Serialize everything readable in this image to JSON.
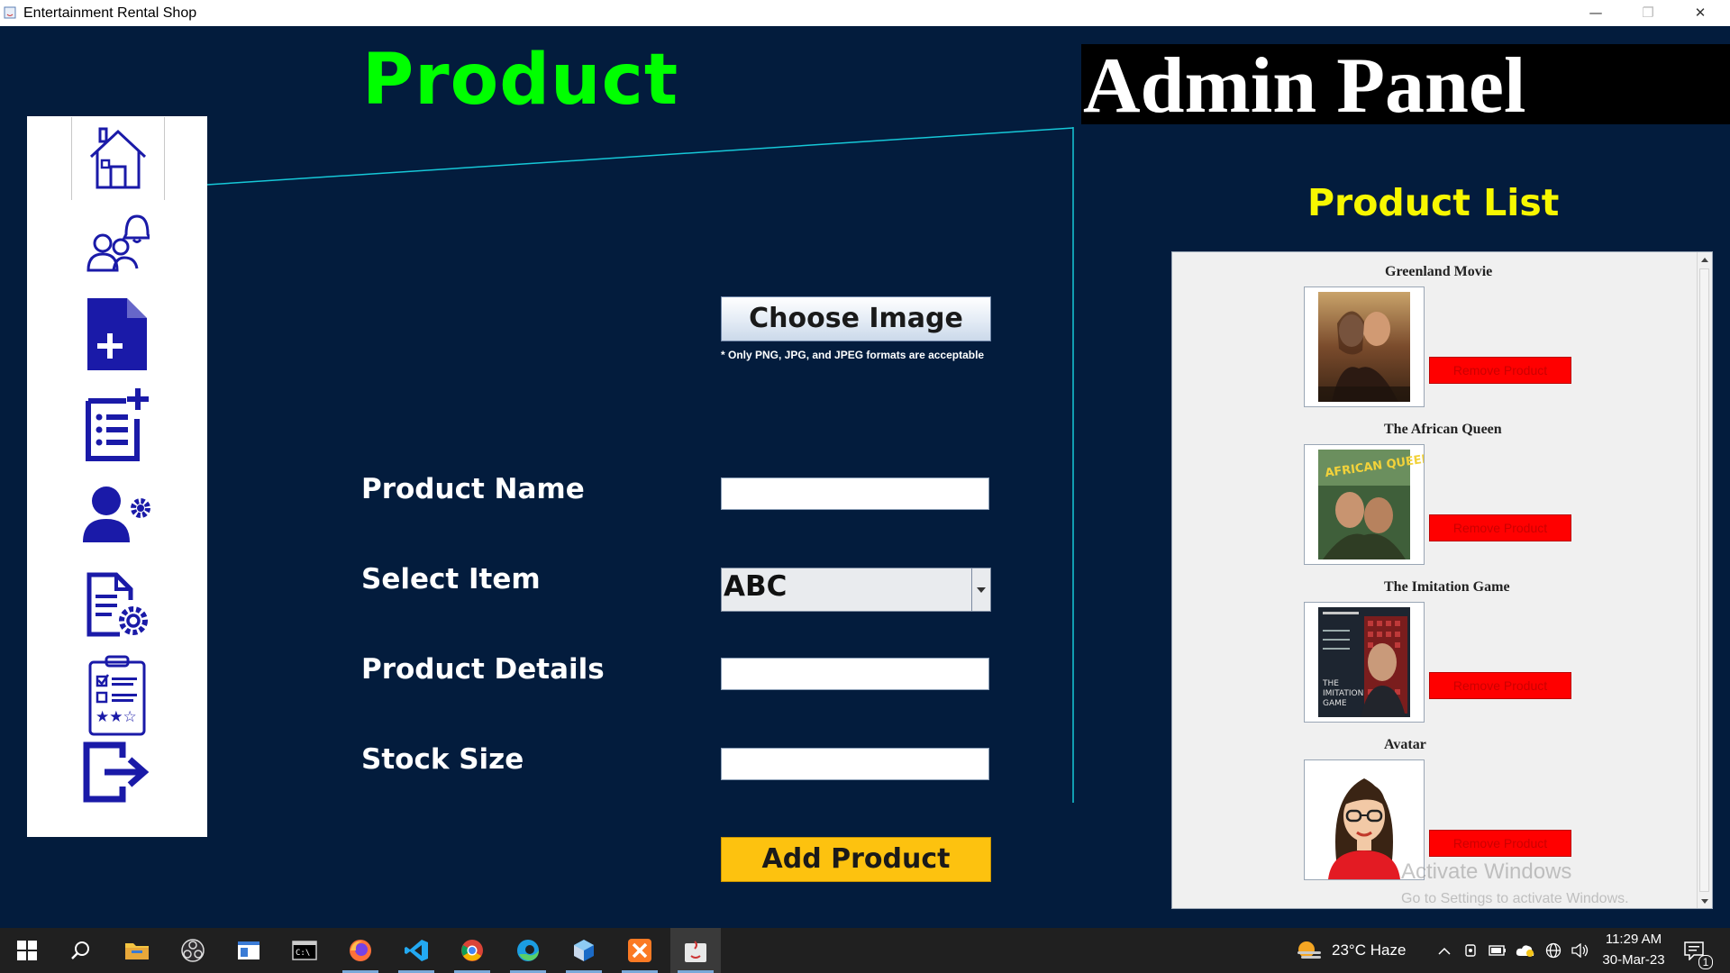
{
  "window": {
    "title": "Entertainment Rental Shop",
    "controls": [
      "minimize",
      "maximize",
      "close"
    ]
  },
  "header": {
    "page_title": "Product",
    "admin_label": "Admin Panel"
  },
  "sidebar": {
    "items": [
      {
        "name": "home",
        "icon": "home-icon",
        "active": true
      },
      {
        "name": "customers-notifications",
        "icon": "users-bell-icon"
      },
      {
        "name": "add-product",
        "icon": "file-plus-icon"
      },
      {
        "name": "product-list",
        "icon": "list-plus-icon"
      },
      {
        "name": "user-settings",
        "icon": "user-gear-icon"
      },
      {
        "name": "document-settings",
        "icon": "document-gear-icon"
      },
      {
        "name": "reviews",
        "icon": "clipboard-stars-icon"
      },
      {
        "name": "logout",
        "icon": "logout-icon"
      }
    ]
  },
  "form": {
    "choose_image_label": "Choose Image",
    "image_hint": "* Only PNG, JPG, and JPEG formats are acceptable",
    "product_name_label": "Product Name",
    "product_name_value": "",
    "select_item_label": "Select Item",
    "select_item_value": "ABC",
    "product_details_label": "Product Details",
    "product_details_value": "",
    "stock_size_label": "Stock Size",
    "stock_size_value": "",
    "add_button_label": "Add Product"
  },
  "product_list": {
    "title": "Product List",
    "items": [
      {
        "name": "Greenland Movie",
        "remove_label": "Remove Product"
      },
      {
        "name": "The African Queen",
        "remove_label": "Remove Product"
      },
      {
        "name": "The Imitation Game",
        "remove_label": "Remove Product"
      },
      {
        "name": "Avatar",
        "remove_label": "Remove Product"
      }
    ]
  },
  "watermark": {
    "line1": "Activate Windows",
    "line2": "Go to Settings to activate Windows."
  },
  "taskbar": {
    "apps": [
      "start-icon",
      "search-icon",
      "file-explorer-icon",
      "obs-icon",
      "notepad-icon",
      "terminal-icon",
      "firefox-icon",
      "vscode-icon",
      "chrome-icon",
      "edge-icon",
      "netbeans-icon",
      "xampp-icon",
      "java-icon"
    ],
    "weather": "23°C  Haze",
    "time": "11:29 AM",
    "date": "30-Mar-23",
    "notification_count": "1"
  },
  "colors": {
    "background": "#031c3d",
    "page_title": "#00ff00",
    "list_title": "#f7f700",
    "add_button": "#fdc20f",
    "remove_button": "#ff0000",
    "sidebar_icons": "#1a1aa8"
  }
}
